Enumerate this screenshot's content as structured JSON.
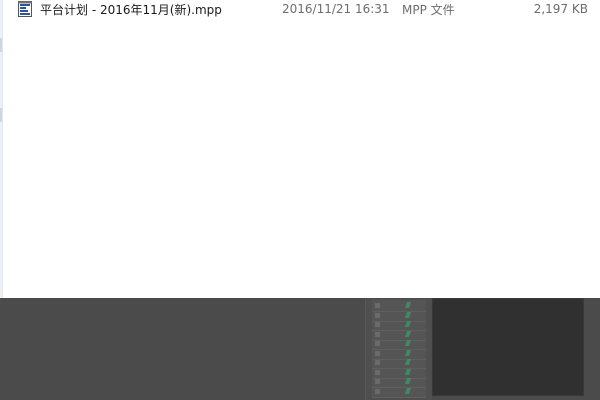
{
  "files": [
    {
      "name": "平台计划 - 2016年11月(新).mpp",
      "modified": "2016/11/21 16:31",
      "type": "MPP 文件",
      "size": "2,197 KB",
      "icon": "ms-project-file-icon"
    }
  ],
  "colors": {
    "window_bg": "#ffffff",
    "secondary_text": "#6d6d6d",
    "background_app": "#4b4b4b",
    "dark_pane": "#303030",
    "icon_blue": "#2b579a"
  }
}
